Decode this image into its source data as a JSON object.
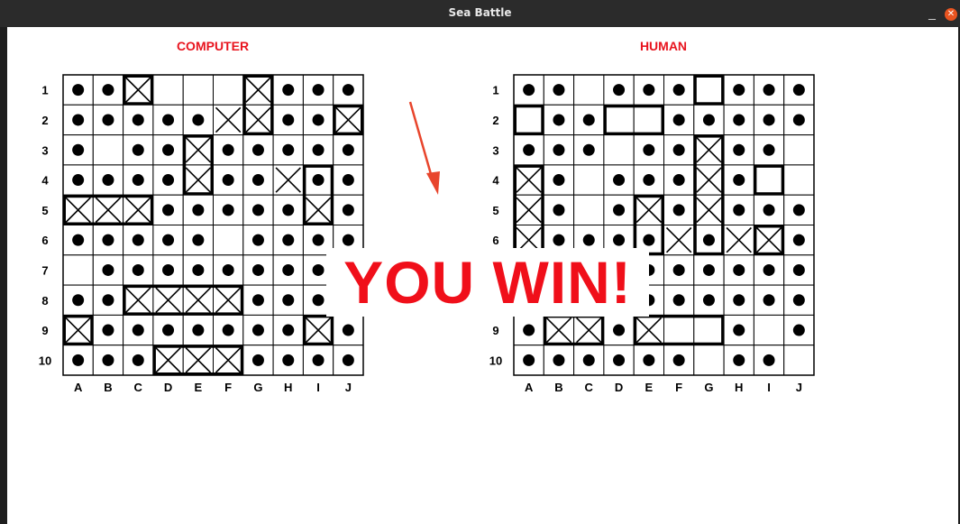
{
  "window": {
    "title": "Sea Battle",
    "minimize_glyph": "_",
    "close_glyph": "✕"
  },
  "colors": {
    "accent": "#e8141e",
    "titlebar": "#2b2b2b",
    "close": "#e95420",
    "arrow": "#e8452c"
  },
  "columns": [
    "A",
    "B",
    "C",
    "D",
    "E",
    "F",
    "G",
    "H",
    "I",
    "J"
  ],
  "rows": [
    "1",
    "2",
    "3",
    "4",
    "5",
    "6",
    "7",
    "8",
    "9",
    "10"
  ],
  "banner": "YOU WIN!",
  "legend": {
    ".": "empty",
    "o": "miss dot",
    "x": "hit ship segment",
    "s": "unhit ship segment"
  },
  "boards": [
    {
      "title": "COMPUTER",
      "cells": [
        "oox...xooo",
        "oooooxxoox",
        "o.ooxooooo",
        "ooooxooxoo",
        "xxxoooooxo",
        "ooooo.oooo",
        ".ooooooooo",
        "ooxxxxoooo",
        "xoooooooxo",
        "oooxxxoooo"
      ],
      "ships": [
        {
          "row": 1,
          "col": 3,
          "len": 1,
          "dir": "h"
        },
        {
          "row": 1,
          "col": 7,
          "len": 2,
          "dir": "v"
        },
        {
          "row": 2,
          "col": 10,
          "len": 1,
          "dir": "h"
        },
        {
          "row": 3,
          "col": 5,
          "len": 2,
          "dir": "v"
        },
        {
          "row": 4,
          "col": 9,
          "len": 2,
          "dir": "v"
        },
        {
          "row": 5,
          "col": 1,
          "len": 3,
          "dir": "h"
        },
        {
          "row": 8,
          "col": 3,
          "len": 4,
          "dir": "h"
        },
        {
          "row": 9,
          "col": 1,
          "len": 1,
          "dir": "h"
        },
        {
          "row": 9,
          "col": 9,
          "len": 1,
          "dir": "h"
        },
        {
          "row": 10,
          "col": 4,
          "len": 3,
          "dir": "h"
        }
      ]
    },
    {
      "title": "HUMAN",
      "cells": [
        "oo.ooosooo",
        "soossooooo",
        "ooo.ooxoo.",
        "xo.oooxos.",
        "xo.oxoxooo",
        "xooooxoxxo",
        "oo..oooooo",
        "oo..oooooo",
        "oxxoxsso.o",
        "oooooo.oo."
      ],
      "ships": [
        {
          "row": 1,
          "col": 7,
          "len": 1,
          "dir": "h"
        },
        {
          "row": 2,
          "col": 1,
          "len": 1,
          "dir": "h"
        },
        {
          "row": 2,
          "col": 4,
          "len": 2,
          "dir": "h"
        },
        {
          "row": 3,
          "col": 7,
          "len": 4,
          "dir": "v"
        },
        {
          "row": 4,
          "col": 1,
          "len": 3,
          "dir": "v"
        },
        {
          "row": 4,
          "col": 9,
          "len": 1,
          "dir": "h"
        },
        {
          "row": 5,
          "col": 5,
          "len": 2,
          "dir": "v"
        },
        {
          "row": 6,
          "col": 9,
          "len": 1,
          "dir": "h"
        },
        {
          "row": 9,
          "col": 2,
          "len": 2,
          "dir": "h"
        },
        {
          "row": 9,
          "col": 5,
          "len": 3,
          "dir": "h"
        }
      ]
    }
  ]
}
